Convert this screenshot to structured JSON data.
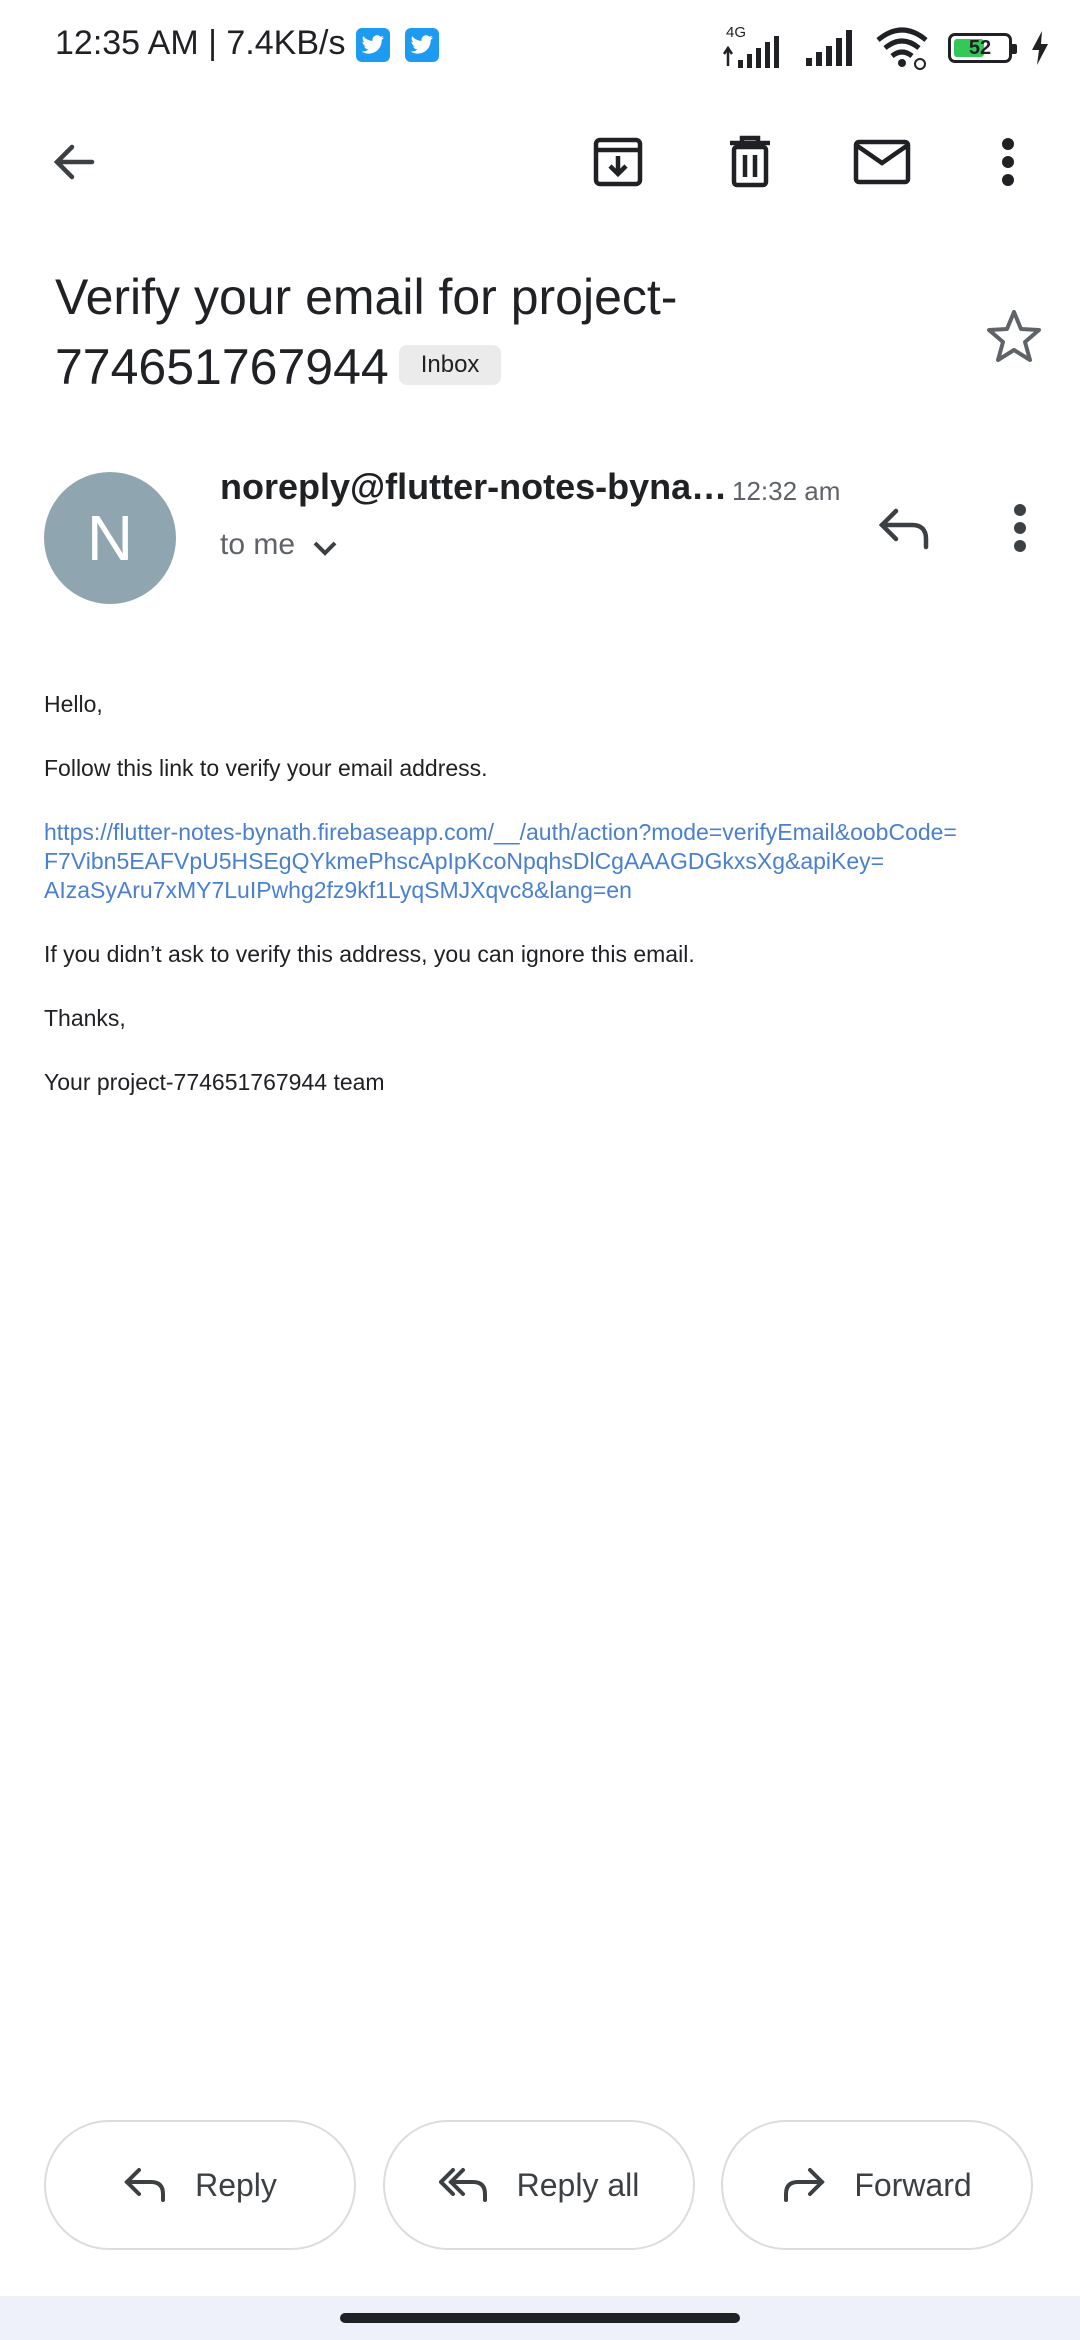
{
  "status_bar": {
    "time_speed": "12:35 AM | 7.4KB/s",
    "network": "4G",
    "battery": "52",
    "icons": [
      "twitter-icon",
      "twitter-icon",
      "signal-icon",
      "wifi-icon",
      "battery-icon",
      "charging-icon"
    ]
  },
  "toolbar": {
    "icons": [
      "back-arrow-icon",
      "archive-icon",
      "delete-icon",
      "mark-unread-icon",
      "more-vert-icon"
    ]
  },
  "email": {
    "subject": "Verify your email for project-774651767944",
    "label": "Inbox",
    "avatar_letter": "N",
    "avatar_color": "#8fa6b1",
    "sender": "noreply@flutter-notes-byna…",
    "time": "12:32 am",
    "to": "to me",
    "body": {
      "greeting": "Hello,",
      "instruction": "Follow this link to verify your email address.",
      "link_line1": "https://flutter-notes-bynath.firebaseapp.com/__/auth/action?mode=verifyEmail&oobCode=",
      "link_line2": "F7Vibn5EAFVpU5HSEgQYkmePhscApIpKcoNpqhsDlCgAAAGDGkxsXg&apiKey=",
      "link_line3": "AIzaSyAru7xMY7LuIPwhg2fz9kf1LyqSMJXqvc8&lang=en",
      "ignore": "If you didn’t ask to verify this address, you can ignore this email.",
      "thanks": "Thanks,",
      "signature": "Your project-774651767944 team"
    }
  },
  "actions": {
    "reply": "Reply",
    "reply_all": "Reply all",
    "forward": "Forward"
  },
  "colors": {
    "link": "#4a7fd1",
    "twitter": "#1d9bf0",
    "battery_fill": "#34c759"
  }
}
